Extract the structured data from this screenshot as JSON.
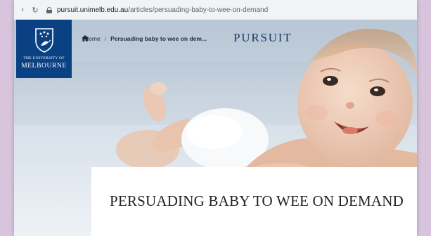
{
  "browser": {
    "url_domain": "pursuit.unimelb.edu.au",
    "url_path": "/articles/persuading-baby-to-wee-on-demand",
    "back_icon": "arrow-right-icon",
    "reload_icon": "reload-icon"
  },
  "logo": {
    "line1": "THE UNIVERSITY OF",
    "line2": "MELBOURNE",
    "background": "#094183"
  },
  "breadcrumb": {
    "home": "Home",
    "separator": "/",
    "current": "Persuading baby to wee on dem..."
  },
  "brand": "PURSUIT",
  "article": {
    "title": "PERSUADING BABY TO WEE ON DEMAND"
  },
  "colors": {
    "brand_blue": "#094183",
    "page_background": "#d9c4dd"
  }
}
